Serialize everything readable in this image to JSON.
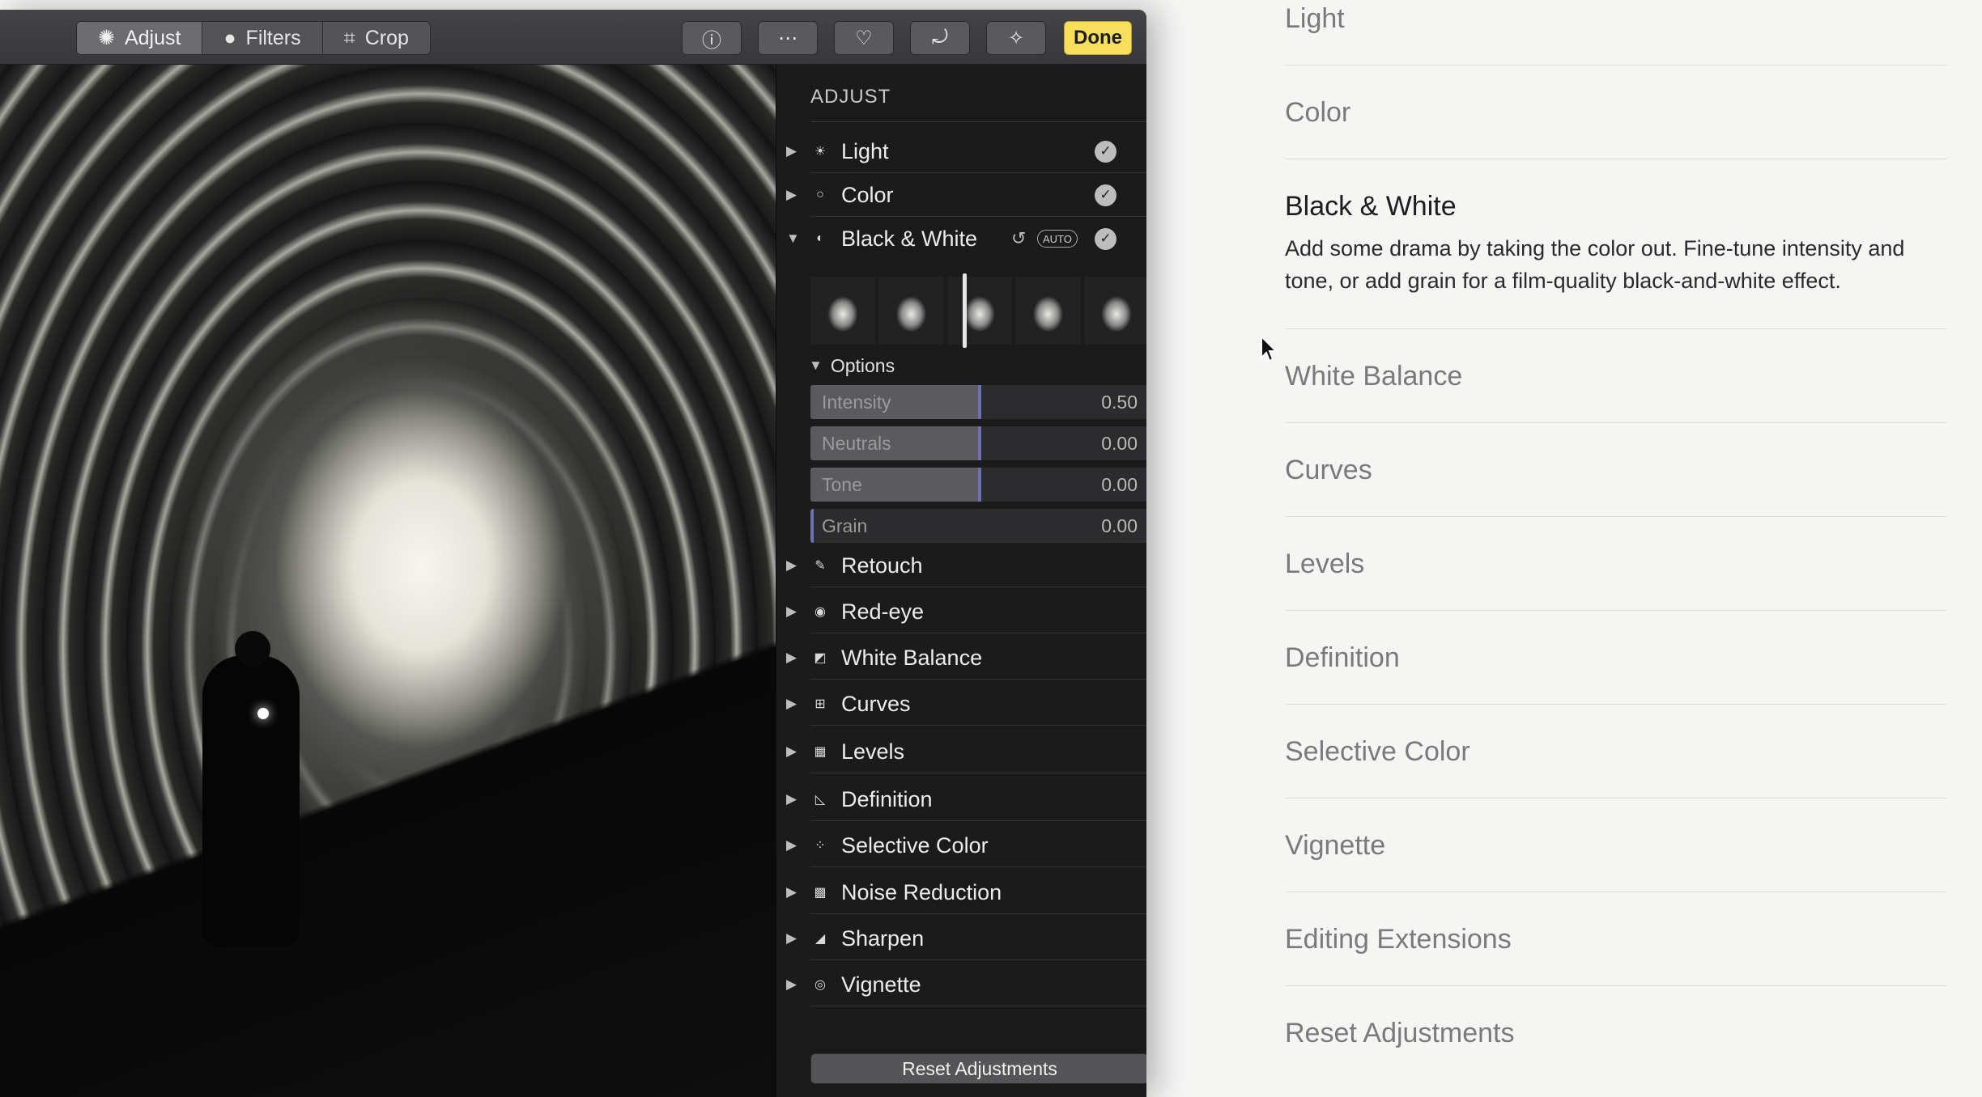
{
  "toolbar": {
    "modes": [
      {
        "label": "Adjust",
        "icon": "adjust-dial-icon",
        "active": true
      },
      {
        "label": "Filters",
        "icon": "filters-icon",
        "active": false
      },
      {
        "label": "Crop",
        "icon": "crop-icon",
        "active": false
      }
    ],
    "tools": [
      {
        "name": "info-button",
        "icon": "info-icon",
        "glyph": "ⓘ"
      },
      {
        "name": "more-extensions-button",
        "icon": "ellipsis-icon",
        "glyph": "⋯"
      },
      {
        "name": "favorite-button",
        "icon": "heart-icon",
        "glyph": "♡"
      },
      {
        "name": "rotate-button",
        "icon": "rotate-icon",
        "glyph": "⤾"
      },
      {
        "name": "enhance-button",
        "icon": "magic-wand-icon",
        "glyph": "✧"
      }
    ],
    "done_label": "Done"
  },
  "panel": {
    "title": "ADJUST",
    "sections": [
      {
        "label": "Light",
        "icon": "sun-icon",
        "glyph": "☀",
        "checked": true
      },
      {
        "label": "Color",
        "icon": "color-circle-icon",
        "glyph": "○",
        "checked": true
      },
      {
        "label": "Black & White",
        "icon": "half-circle-icon",
        "glyph": "◐",
        "checked": true,
        "expanded": true,
        "auto_label": "AUTO"
      }
    ],
    "options_label": "Options",
    "sliders": [
      {
        "name": "Intensity",
        "value": "0.50",
        "level": 0.5
      },
      {
        "name": "Neutrals",
        "value": "0.00",
        "level": 0.5
      },
      {
        "name": "Tone",
        "value": "0.00",
        "level": 0.5
      },
      {
        "name": "Grain",
        "value": "0.00",
        "level": 0.0
      }
    ],
    "more_sections": [
      {
        "label": "Retouch",
        "icon": "bandage-icon",
        "glyph": "✎"
      },
      {
        "label": "Red-eye",
        "icon": "eye-icon",
        "glyph": "◉"
      },
      {
        "label": "White Balance",
        "icon": "white-balance-icon",
        "glyph": "◩"
      },
      {
        "label": "Curves",
        "icon": "curves-icon",
        "glyph": "⊞"
      },
      {
        "label": "Levels",
        "icon": "levels-icon",
        "glyph": "▦"
      },
      {
        "label": "Definition",
        "icon": "definition-icon",
        "glyph": "◺"
      },
      {
        "label": "Selective Color",
        "icon": "selective-color-icon",
        "glyph": "⁘"
      },
      {
        "label": "Noise Reduction",
        "icon": "noise-reduction-icon",
        "glyph": "▩"
      },
      {
        "label": "Sharpen",
        "icon": "sharpen-icon",
        "glyph": "◢"
      },
      {
        "label": "Vignette",
        "icon": "vignette-icon",
        "glyph": "◎"
      }
    ],
    "reset_label": "Reset Adjustments"
  },
  "help": {
    "items": [
      {
        "title": "Light"
      },
      {
        "title": "Color"
      },
      {
        "title": "Black & White",
        "active": true,
        "description": "Add some drama by taking the color out. Fine-tune intensity and tone, or add grain for a film-quality black-and-white effect."
      },
      {
        "title": "White Balance"
      },
      {
        "title": "Curves"
      },
      {
        "title": "Levels"
      },
      {
        "title": "Definition"
      },
      {
        "title": "Selective Color"
      },
      {
        "title": "Vignette"
      },
      {
        "title": "Editing Extensions"
      },
      {
        "title": "Reset Adjustments"
      }
    ]
  }
}
